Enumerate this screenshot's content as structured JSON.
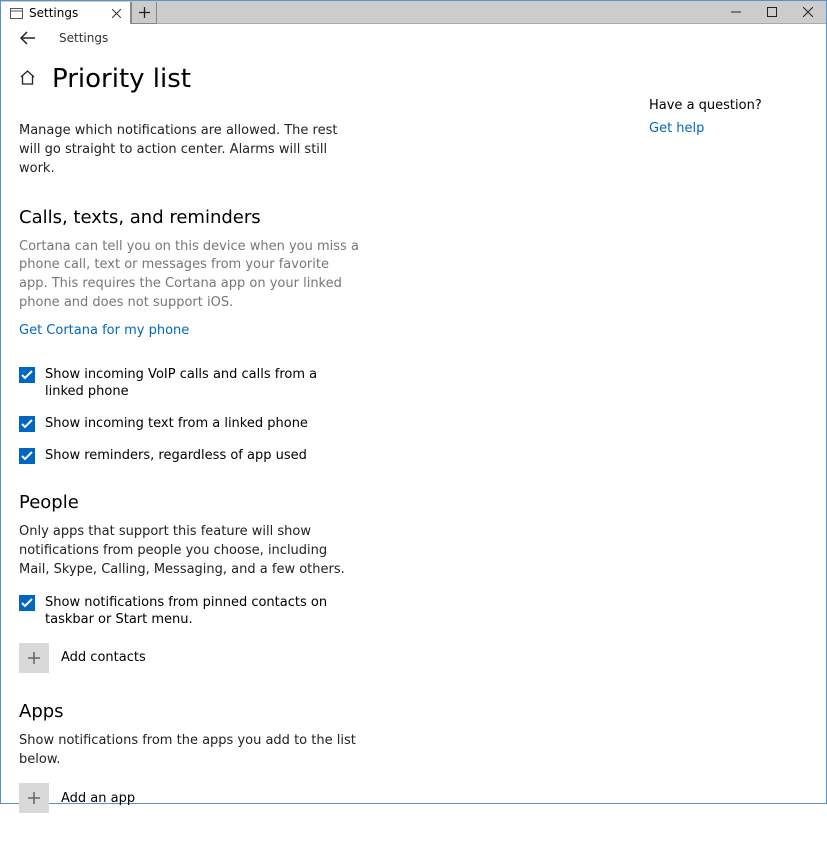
{
  "window": {
    "tab_title": "Settings",
    "breadcrumb": "Settings"
  },
  "page": {
    "title": "Priority list",
    "intro": "Manage which notifications are allowed. The rest will go straight to action center. Alarms will still work."
  },
  "calls": {
    "heading": "Calls, texts, and reminders",
    "desc": "Cortana can tell you on this device when you miss a phone call, text or messages from your favorite app. This requires the Cortana app on your linked phone and does not support iOS.",
    "link": "Get Cortana for my phone",
    "opt_voip": "Show incoming VoIP calls and calls from a linked phone",
    "opt_text": "Show incoming text from a linked phone",
    "opt_reminders": "Show reminders, regardless of app used"
  },
  "people": {
    "heading": "People",
    "desc": "Only apps that support this feature will show notifications from people you choose, including Mail, Skype, Calling, Messaging, and a few others.",
    "opt_pinned": "Show notifications from pinned contacts on taskbar or Start menu.",
    "add_label": "Add contacts"
  },
  "apps": {
    "heading": "Apps",
    "desc": "Show notifications from the apps you add to the list below.",
    "add_label": "Add an app"
  },
  "side": {
    "question": "Have a question?",
    "help_link": "Get help"
  }
}
